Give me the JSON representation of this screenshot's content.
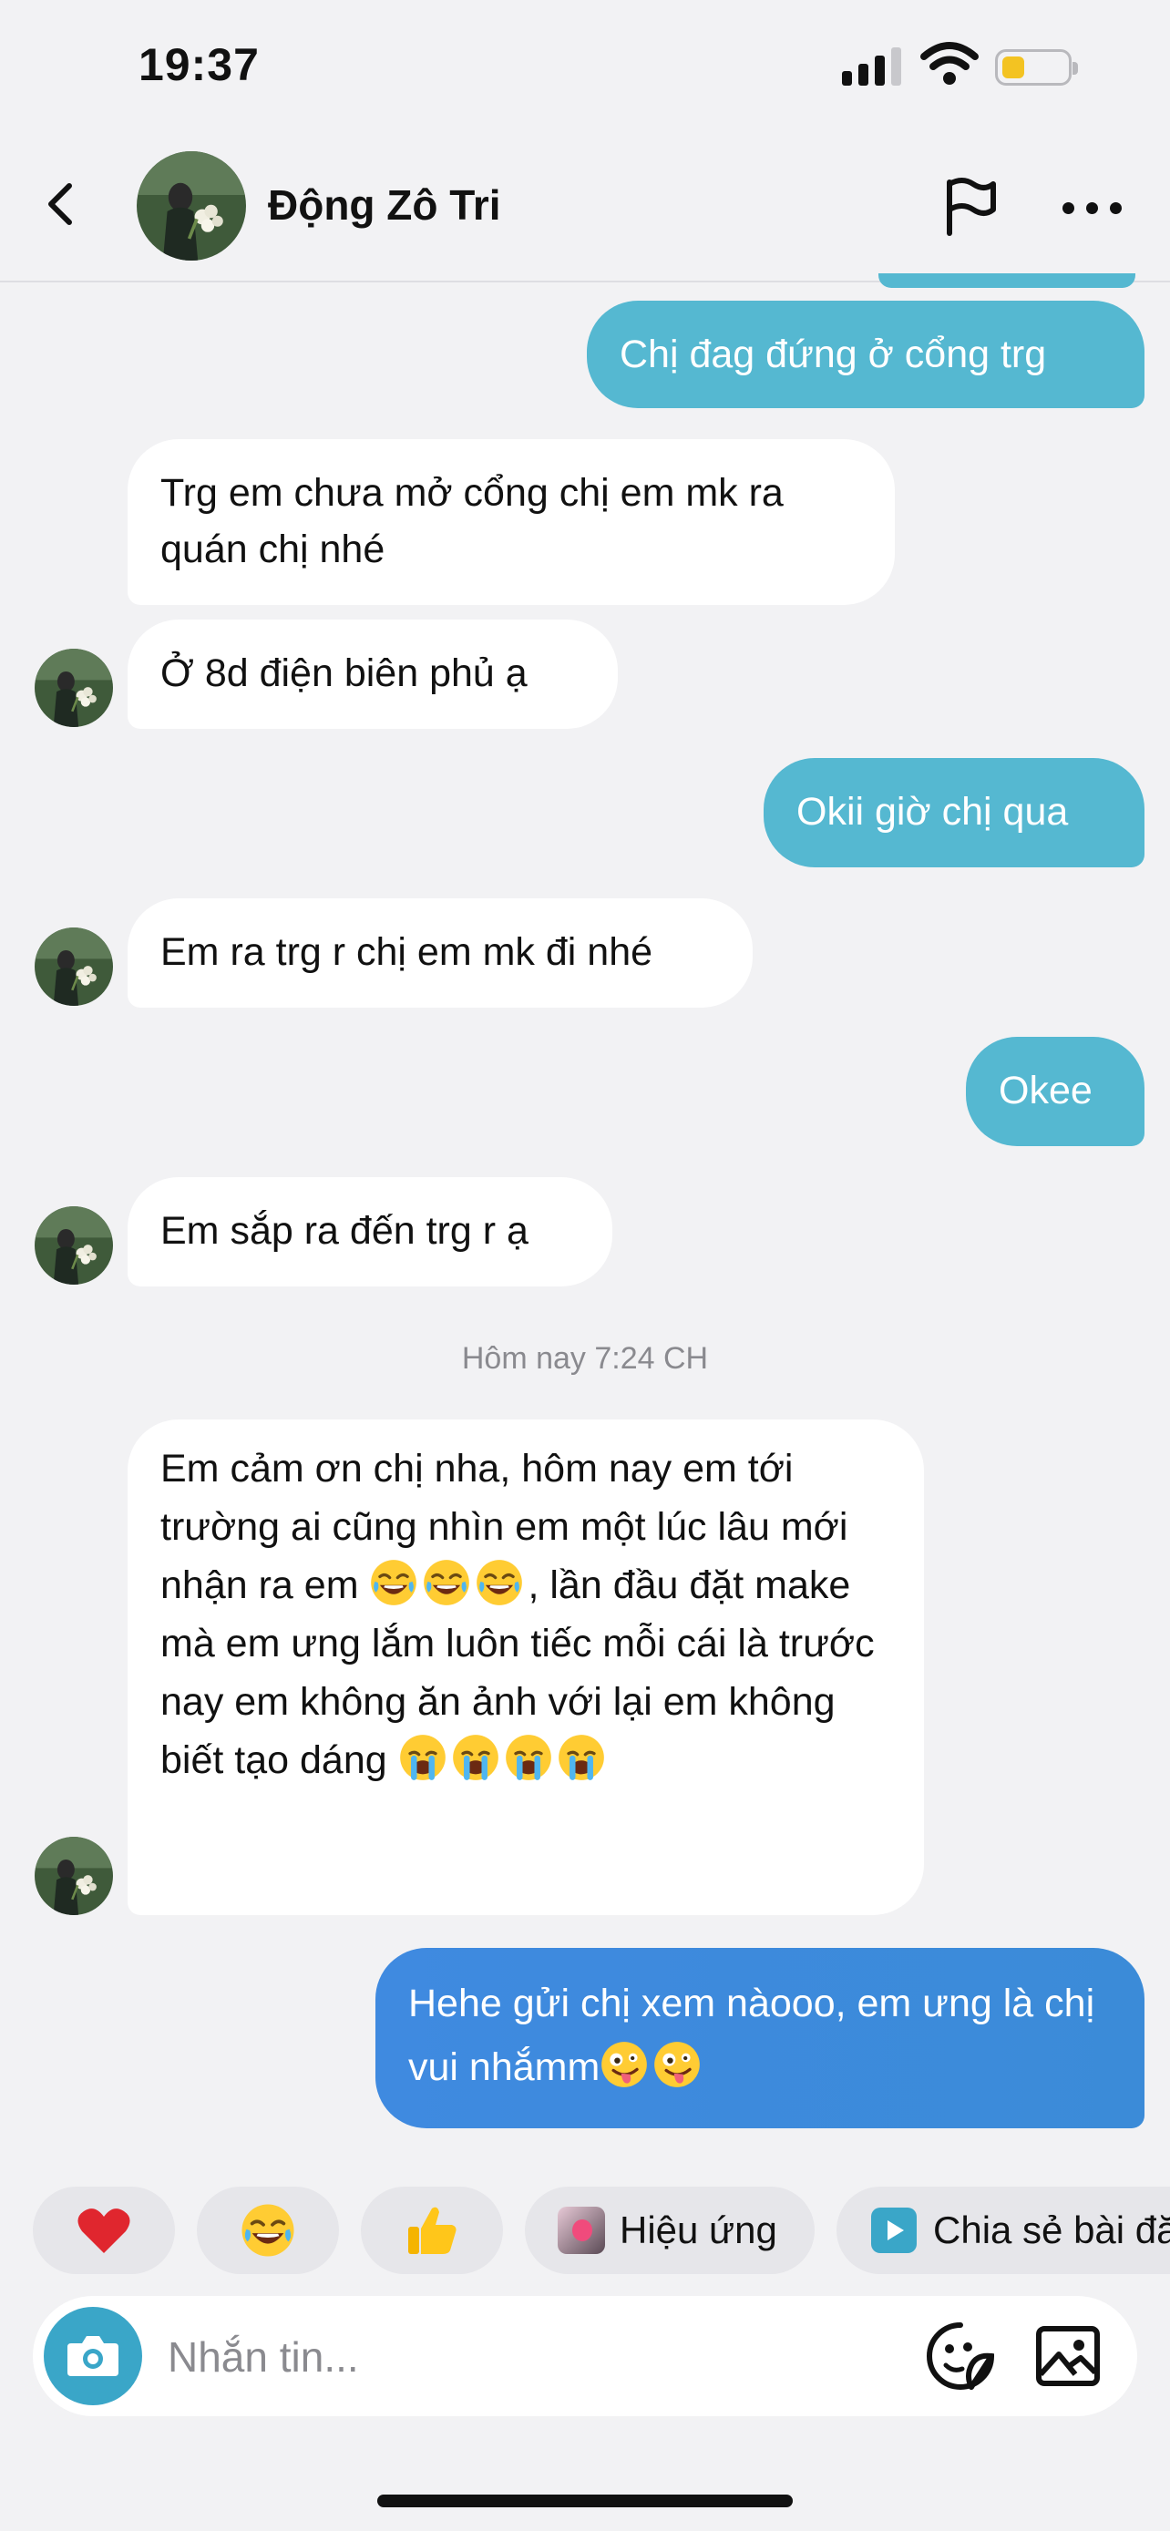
{
  "status_bar": {
    "time": "19:37"
  },
  "header": {
    "contact_name": "Động Zô Tri"
  },
  "messages": [
    {
      "side": "out",
      "text": "Chị đag đứng ở cổng trg"
    },
    {
      "side": "in",
      "text": "Trg em chưa mở cổng chị em mk ra quán chị nhé"
    },
    {
      "side": "in",
      "text": "Ở 8d điện biên phủ ạ"
    },
    {
      "side": "out",
      "text": "Okii giờ chị qua"
    },
    {
      "side": "in",
      "text": "Em ra trg r chị em mk đi nhé"
    },
    {
      "side": "out",
      "text": "Okee"
    },
    {
      "side": "in",
      "text": "Em sắp ra đến trg r ạ"
    },
    {
      "side": "in",
      "text_a": "Em cảm ơn chị nha, hôm nay em tới trường ai cũng nhìn em một lúc lâu mới nhận ra em",
      "text_b": ", lần đầu đặt make mà em ưng lắm luôn tiếc mỗi cái là trước nay em không ăn ảnh với lại em không biết tạo dáng"
    },
    {
      "side": "out",
      "text": "Hehe gửi chị xem nàooo, em ưng là chị vui nhắmm"
    }
  ],
  "timestamp": "Hôm nay 7:24 CH",
  "quick_reactions": {
    "items": [
      {
        "icon": "heart-icon"
      },
      {
        "icon": "laughing-emoji-icon"
      },
      {
        "icon": "thumbs-up-icon"
      }
    ],
    "effects_label": "Hiệu ứng",
    "share_label": "Chia sẻ bài đă"
  },
  "composer": {
    "placeholder": "Nhắn tin..."
  },
  "colors": {
    "outgoing": "#55b8d1",
    "outgoing_latest": "#3f8ae0",
    "incoming": "#ffffff",
    "background": "#f2f2f4"
  }
}
